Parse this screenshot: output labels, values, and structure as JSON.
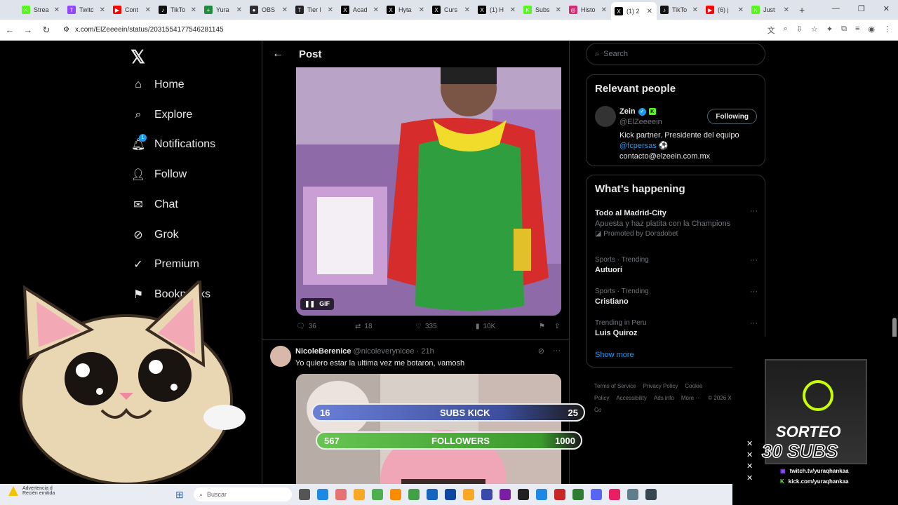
{
  "browser": {
    "tabs": [
      {
        "label": "Strea",
        "color": "#53fc18",
        "glyph": "K"
      },
      {
        "label": "Twitc",
        "color": "#9146ff",
        "glyph": "T"
      },
      {
        "label": "Cont",
        "color": "#ff0000",
        "glyph": "▶"
      },
      {
        "label": "TikTo",
        "color": "#111111",
        "glyph": "♪"
      },
      {
        "label": "Yura",
        "color": "#1e8e3e",
        "glyph": "+"
      },
      {
        "label": "OBS",
        "color": "#302e31",
        "glyph": "●"
      },
      {
        "label": "Tier l",
        "color": "#222222",
        "glyph": "T"
      },
      {
        "label": "Acad",
        "color": "#000000",
        "glyph": "X"
      },
      {
        "label": "Hyta",
        "color": "#000000",
        "glyph": "X"
      },
      {
        "label": "Curs",
        "color": "#000000",
        "glyph": "X"
      },
      {
        "label": "(1) H",
        "color": "#000000",
        "glyph": "X"
      },
      {
        "label": "Subs",
        "color": "#53fc18",
        "glyph": "K"
      },
      {
        "label": "Histo",
        "color": "#d62976",
        "glyph": "◎"
      },
      {
        "label": "(1) 2",
        "color": "#000000",
        "glyph": "X"
      },
      {
        "label": "TikTo",
        "color": "#111111",
        "glyph": "♪"
      },
      {
        "label": "(6) j",
        "color": "#ff0000",
        "glyph": "▶"
      },
      {
        "label": "Just",
        "color": "#53fc18",
        "glyph": "K"
      }
    ],
    "active_tab_index": 13,
    "url": "x.com/ElZeeeein/status/2031554177546281145"
  },
  "nav": {
    "items": [
      {
        "label": "Home",
        "icon": "home-icon"
      },
      {
        "label": "Explore",
        "icon": "search-icon"
      },
      {
        "label": "Notifications",
        "icon": "bell-icon",
        "badge": "1"
      },
      {
        "label": "Follow",
        "icon": "person-plus-icon"
      },
      {
        "label": "Chat",
        "icon": "mail-icon"
      },
      {
        "label": "Grok",
        "icon": "grok-icon"
      },
      {
        "label": "Premium",
        "icon": "verified-icon"
      },
      {
        "label": "Bookmarks",
        "icon": "bookmark-icon"
      }
    ]
  },
  "post": {
    "header_title": "Post",
    "gif_label": "GIF",
    "stats": {
      "replies": "36",
      "reposts": "18",
      "likes": "335",
      "views": "10K"
    }
  },
  "reply": {
    "name": "NicoleBerenice",
    "handle": "@nicoleverynicee",
    "time": "· 21h",
    "text": "Yo quiero estar la ultima vez me botaron, vamosh"
  },
  "sidebar": {
    "search_placeholder": "Search",
    "relevant_title": "Relevant people",
    "person": {
      "name": "Zein",
      "handle": "@ElZeeeein",
      "follow_label": "Following",
      "bio_line1": "Kick partner. Presidente del equipo",
      "bio_link": "@fcpersas",
      "bio_line3": "contacto@elzeein.com.mx"
    },
    "happening_title": "What’s happening",
    "trends": [
      {
        "meta": "",
        "title": "Todo al Madrid-City",
        "desc": "Apuesta y haz platita con la Champions",
        "promo": "Promoted by Doradobet"
      },
      {
        "meta": "Sports · Trending",
        "title": "Autuori",
        "desc": "",
        "promo": ""
      },
      {
        "meta": "Sports · Trending",
        "title": "Cristiano",
        "desc": "",
        "promo": ""
      },
      {
        "meta": "Trending in Peru",
        "title": "Luis Quiroz",
        "desc": "",
        "promo": ""
      }
    ],
    "show_more": "Show more",
    "footer": [
      "Terms of Service",
      "Privacy Policy",
      "Cookie Policy",
      "Accessibility",
      "Ads info",
      "More ···",
      "© 2026 X Co"
    ]
  },
  "overlay": {
    "subs": {
      "current": "16",
      "label": "SUBS KICK",
      "goal": "25"
    },
    "followers": {
      "current": "567",
      "label": "FOLLOWERS",
      "goal": "1000"
    },
    "promo_title1": "SORTEO",
    "promo_title2": "30 SUBS",
    "promo_twitch": "twitch.tv/yuraqhankaa",
    "promo_kick": "kick.com/yuraqhankaa"
  },
  "taskbar": {
    "warning_title": "Advertencia d",
    "warning_sub": "Recién emitida",
    "search_placeholder": "Buscar"
  }
}
